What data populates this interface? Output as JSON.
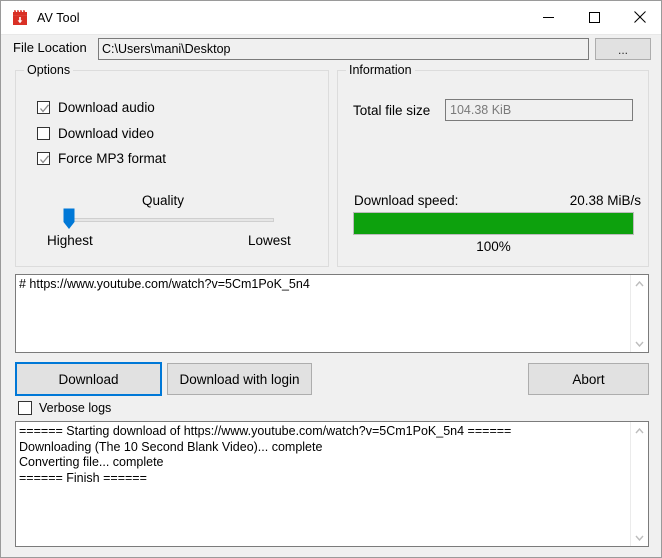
{
  "window": {
    "title": "AV Tool",
    "icon": "clapperboard-download-icon",
    "controls": {
      "minimize": "minimize-icon",
      "maximize": "maximize-icon",
      "close": "close-icon"
    }
  },
  "file_location": {
    "label": "File Location",
    "value": "C:\\Users\\mani\\Desktop",
    "placeholder": "",
    "browse_label": "..."
  },
  "options": {
    "title": "Options",
    "checkboxes": [
      {
        "label": "Download audio",
        "checked": true
      },
      {
        "label": "Download video",
        "checked": false
      },
      {
        "label": "Force MP3 format",
        "checked": true
      }
    ],
    "quality": {
      "label": "Quality",
      "left_label": "Highest",
      "right_label": "Lowest",
      "value_percent": 0
    }
  },
  "information": {
    "title": "Information",
    "total_file_size_label": "Total file size",
    "total_file_size_value": "104.38 KiB",
    "download_speed_label": "Download speed:",
    "download_speed_value": "20.38 MiB/s",
    "progress_percent_label": "100%",
    "progress_percent": 100,
    "progress_color": "#0da10d"
  },
  "url_input": {
    "value": "# https://www.youtube.com/watch?v=5Cm1PoK_5n4",
    "placeholder": ""
  },
  "actions": {
    "download_label": "Download",
    "download_with_login_label": "Download with login",
    "abort_label": "Abort",
    "focus_color": "#0078d7"
  },
  "verbose": {
    "label": "Verbose logs",
    "checked": false
  },
  "log": {
    "text": "====== Starting download of https://www.youtube.com/watch?v=5Cm1PoK_5n4 ======\nDownloading (The 10 Second Blank Video)... complete\nConverting file... complete\n====== Finish ======"
  }
}
